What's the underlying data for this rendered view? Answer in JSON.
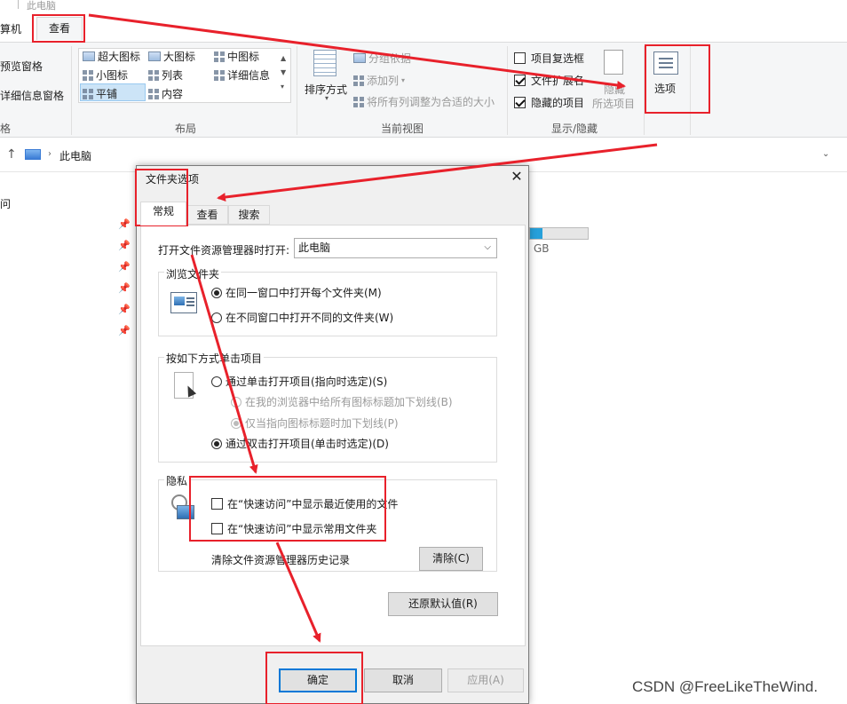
{
  "window": {
    "title": "此电脑"
  },
  "ribbon": {
    "tab_left": "算机",
    "tab_view": "查看",
    "pane": {
      "preview": "预览窗格",
      "details": "详细信息窗格",
      "label": "格"
    },
    "layout": {
      "items": [
        "超大图标",
        "大图标",
        "中图标",
        "小图标",
        "列表",
        "详细信息",
        "平铺",
        "内容"
      ],
      "label": "布局"
    },
    "current_view": {
      "sort": "排序方式",
      "group": "分组依据",
      "add_column": "添加列",
      "fit_columns": "将所有列调整为合适的大小",
      "label": "当前视图"
    },
    "show_hide": {
      "item_checkbox": "项目复选框",
      "extensions": "文件扩展名",
      "hidden_items": "隐藏的项目",
      "hide_selected": "隐藏",
      "hide_selected2": "所选项目",
      "label": "显示/隐藏"
    },
    "options": "选项"
  },
  "address": {
    "location": "此电脑"
  },
  "left_pane": {
    "quick": "问"
  },
  "drive": {
    "unit": "GB",
    "used_fraction": 0.21
  },
  "dialog": {
    "title": "文件夹选项",
    "close": "✕",
    "tabs": [
      "常规",
      "查看",
      "搜索"
    ],
    "open_in_label": "打开文件资源管理器时打开:",
    "open_in_value": "此电脑",
    "browse": {
      "label": "浏览文件夹",
      "same_window": "在同一窗口中打开每个文件夹(M)",
      "new_window": "在不同窗口中打开不同的文件夹(W)"
    },
    "click": {
      "label": "按如下方式单击项目",
      "single": "通过单击打开项目(指向时选定)(S)",
      "underline_all": "在我的浏览器中给所有图标标题加下划线(B)",
      "underline_hover": "仅当指向图标标题时加下划线(P)",
      "double": "通过双击打开项目(单击时选定)(D)"
    },
    "privacy": {
      "label": "隐私",
      "recent_files": "在“快速访问”中显示最近使用的文件",
      "frequent_folders": "在“快速访问”中显示常用文件夹",
      "clear_label": "清除文件资源管理器历史记录",
      "clear_button": "清除(C)"
    },
    "restore_defaults": "还原默认值(R)",
    "ok": "确定",
    "cancel": "取消",
    "apply": "应用(A)"
  },
  "watermark": "CSDN @FreeLikeTheWind.",
  "colors": {
    "annotation_red": "#e8212b",
    "accent_blue": "#0078d7"
  }
}
